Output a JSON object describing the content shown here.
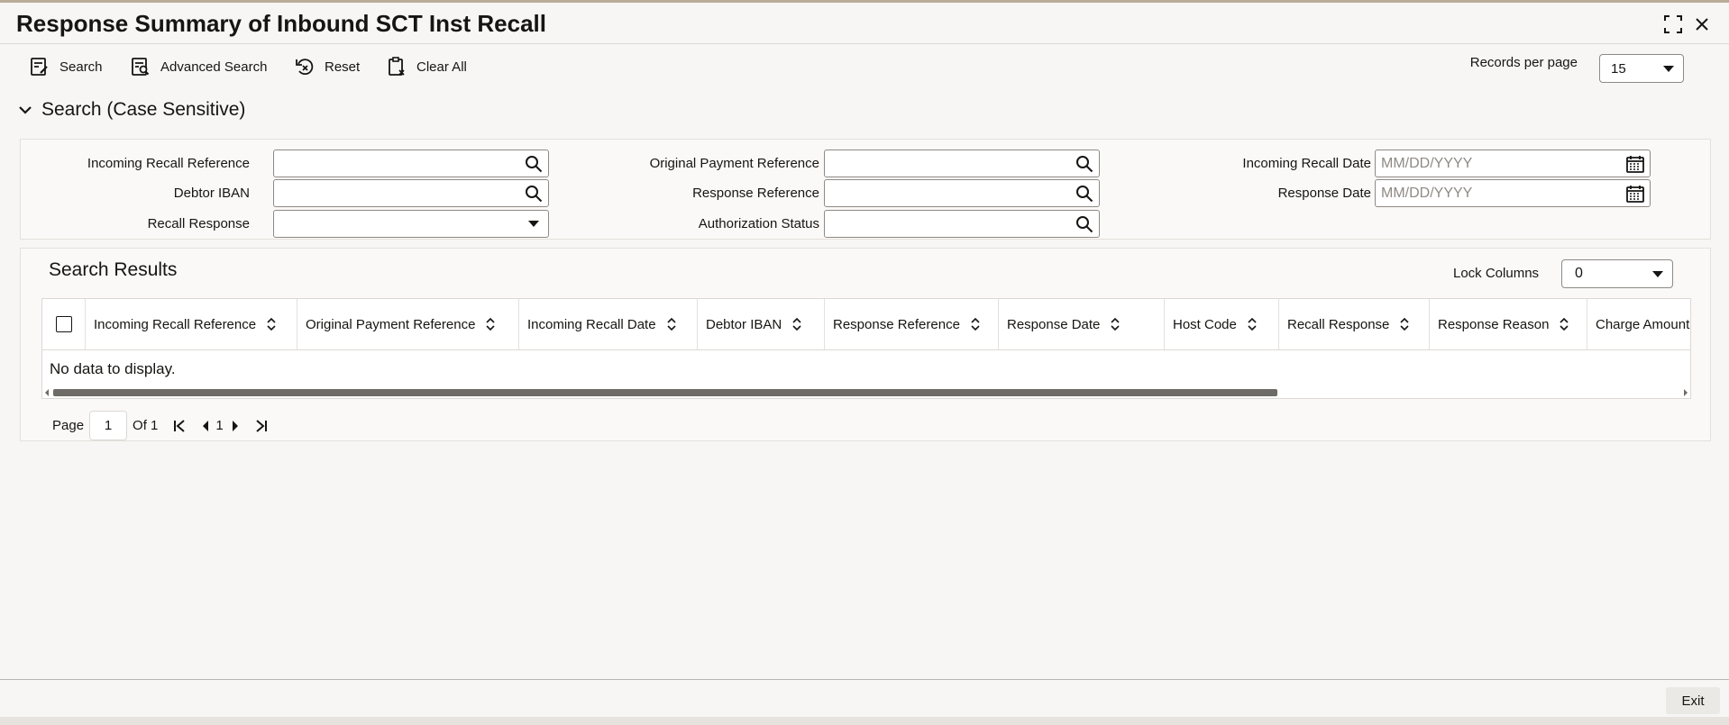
{
  "window": {
    "title": "Response Summary of Inbound SCT Inst Recall"
  },
  "toolbar": {
    "search_label": "Search",
    "advanced_search_label": "Advanced Search",
    "reset_label": "Reset",
    "clear_all_label": "Clear All",
    "records_per_page_label": "Records per page",
    "records_per_page_value": "15"
  },
  "search_section": {
    "heading": "Search (Case Sensitive)",
    "fields": {
      "incoming_recall_reference": {
        "label": "Incoming Recall Reference",
        "value": ""
      },
      "debtor_iban": {
        "label": "Debtor IBAN",
        "value": ""
      },
      "recall_response": {
        "label": "Recall Response",
        "value": ""
      },
      "original_payment_reference": {
        "label": "Original Payment Reference",
        "value": ""
      },
      "response_reference": {
        "label": "Response Reference",
        "value": ""
      },
      "authorization_status": {
        "label": "Authorization Status",
        "value": ""
      },
      "incoming_recall_date": {
        "label": "Incoming Recall Date",
        "placeholder": "MM/DD/YYYY"
      },
      "response_date": {
        "label": "Response Date",
        "placeholder": "MM/DD/YYYY"
      }
    }
  },
  "results": {
    "heading": "Search Results",
    "lock_columns_label": "Lock Columns",
    "lock_columns_value": "0",
    "columns": [
      "Incoming Recall Reference",
      "Original Payment Reference",
      "Incoming Recall Date",
      "Debtor IBAN",
      "Response Reference",
      "Response Date",
      "Host Code",
      "Recall Response",
      "Response Reason",
      "Charge Amount"
    ],
    "empty_message": "No data to display."
  },
  "pagination": {
    "page_label": "Page",
    "current_page": "1",
    "of_label": "Of 1",
    "page_number": "1"
  },
  "footer": {
    "exit_label": "Exit"
  },
  "colors": {
    "text": "#161513",
    "border": "#8e8a85",
    "background": "#f7f6f4"
  }
}
